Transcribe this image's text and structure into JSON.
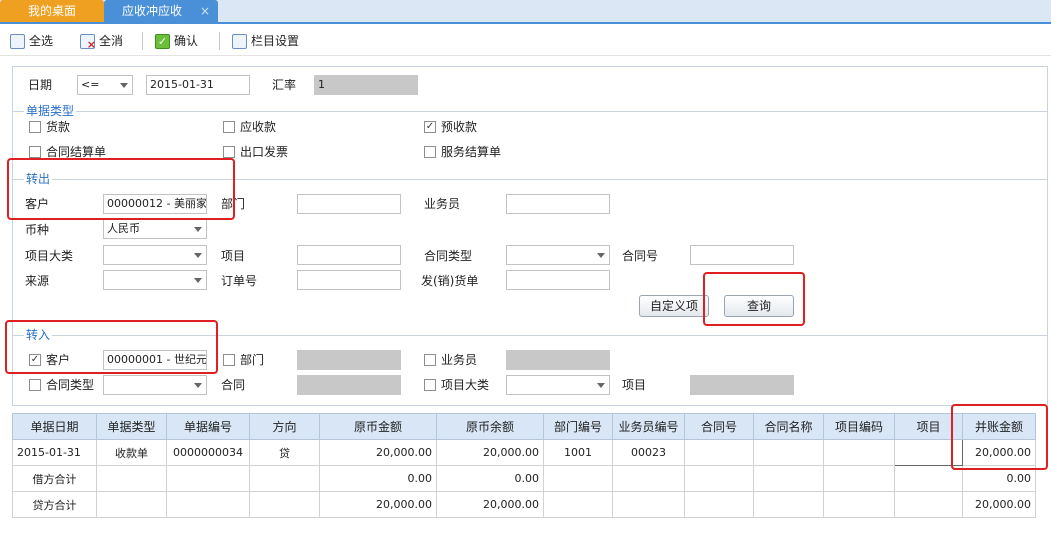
{
  "tabs": {
    "home": "我的桌面",
    "active": "应收冲应收",
    "close": "×"
  },
  "toolbar": {
    "select_all": "全选",
    "deselect_all": "全消",
    "confirm": "确认",
    "column_settings": "栏目设置"
  },
  "filter": {
    "date_label": "日期",
    "date_op": "<=",
    "date_value": "2015-01-31",
    "rate_label": "汇率",
    "rate_value": "1"
  },
  "doc_type": {
    "title": "单据类型",
    "items": [
      {
        "label": "货款",
        "checked": ""
      },
      {
        "label": "应收款",
        "checked": ""
      },
      {
        "label": "预收款",
        "checked": "✓"
      },
      {
        "label": "合同结算单",
        "checked": ""
      },
      {
        "label": "出口发票",
        "checked": ""
      },
      {
        "label": "服务结算单",
        "checked": ""
      }
    ]
  },
  "transfer_out": {
    "title": "转出",
    "customer_label": "客户",
    "customer_value": "00000012 - 美丽家",
    "dept_label": "部门",
    "salesman_label": "业务员",
    "currency_label": "币种",
    "currency_value": "人民币",
    "item_category_label": "项目大类",
    "item_label": "项目",
    "contract_type_label": "合同类型",
    "contract_no_label": "合同号",
    "source_label": "来源",
    "order_no_label": "订单号",
    "invoice_label": "发(销)货单",
    "custom_button": "自定义项",
    "query_button": "查询"
  },
  "transfer_in": {
    "title": "转入",
    "customer_checked": "✓",
    "customer_label": "客户",
    "customer_value": "00000001 - 世纪元",
    "dept_label": "部门",
    "salesman_label": "业务员",
    "contract_type_label": "合同类型",
    "contract_label": "合同",
    "item_category_label": "项目大类",
    "item_label": "项目"
  },
  "grid": {
    "headers": [
      "单据日期",
      "单据类型",
      "单据编号",
      "方向",
      "原币金额",
      "原币余额",
      "部门编号",
      "业务员编号",
      "合同号",
      "合同名称",
      "项目编码",
      "项目",
      "并账金额"
    ],
    "rows": [
      [
        "2015-01-31",
        "收款单",
        "0000000034",
        "贷",
        "20,000.00",
        "20,000.00",
        "1001",
        "00023",
        "",
        "",
        "",
        "",
        "20,000.00"
      ],
      [
        "借方合计",
        "",
        "",
        "",
        "0.00",
        "0.00",
        "",
        "",
        "",
        "",
        "",
        "",
        "0.00"
      ],
      [
        "贷方合计",
        "",
        "",
        "",
        "20,000.00",
        "20,000.00",
        "",
        "",
        "",
        "",
        "",
        "",
        "20,000.00"
      ]
    ]
  },
  "colors": {
    "accent": "#4a90d9",
    "home_tab": "#f0a020",
    "highlight": "#e02020",
    "header_bg": "#d8e6f6"
  }
}
